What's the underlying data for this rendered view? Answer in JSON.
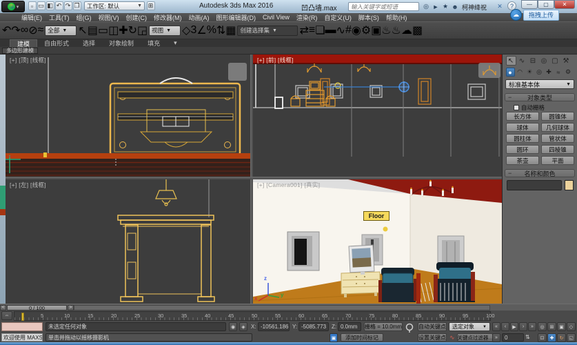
{
  "window": {
    "title": "Autodesk 3ds Max 2016",
    "doc": "凹凸墙.max",
    "workspace": "工作区: 默认",
    "search_placeholder": "输入关键字或短语",
    "username": "柯神绛祝",
    "upload_badge": "拖拽上传",
    "help": "?",
    "quick_icons": [
      {
        "n": "new-file-icon",
        "g": "▫"
      },
      {
        "n": "open-file-icon",
        "g": "▭"
      },
      {
        "n": "save-file-icon",
        "g": "◧"
      },
      {
        "n": "undo-quick-icon",
        "g": "↶"
      },
      {
        "n": "redo-quick-icon",
        "g": "↷"
      },
      {
        "n": "project-folder-icon",
        "g": "❐"
      }
    ],
    "title_icons": [
      {
        "n": "search-go-icon",
        "g": "◎"
      },
      {
        "n": "signin-icon",
        "g": "►"
      },
      {
        "n": "favorites-star-icon",
        "g": "★"
      },
      {
        "n": "user-icon",
        "g": "☻"
      }
    ],
    "controls": [
      {
        "n": "minimize-button",
        "g": "—"
      },
      {
        "n": "maximize-button",
        "g": "▢"
      },
      {
        "n": "close-button",
        "g": "✕",
        "cls": "close"
      }
    ]
  },
  "menu": {
    "items": [
      "编辑(E)",
      "工具(T)",
      "组(G)",
      "视图(V)",
      "创建(C)",
      "修改器(M)",
      "动画(A)",
      "图形编辑器(D)",
      "Civil View",
      "渲染(R)",
      "自定义(U)",
      "脚本(S)",
      "帮助(H)"
    ]
  },
  "toolbar": {
    "filter_label": "全部",
    "refcoord_label": "视图",
    "named_sets_label": "创建选择集",
    "icons_a": [
      {
        "n": "undo-icon",
        "g": "↶"
      },
      {
        "n": "redo-icon",
        "g": "↷"
      },
      {
        "n": "separator",
        "cls": "sep",
        "g": ""
      },
      {
        "n": "select-and-link-icon",
        "g": "∞"
      },
      {
        "n": "unlink-selection-icon",
        "g": "⊘"
      },
      {
        "n": "bind-to-spacewarp-icon",
        "g": "≈"
      },
      {
        "n": "separator",
        "cls": "sep",
        "g": ""
      }
    ],
    "icons_b": [
      {
        "n": "select-object-icon",
        "g": "↖"
      },
      {
        "n": "select-by-name-icon",
        "g": "▤"
      },
      {
        "n": "rect-selection-region-icon",
        "g": "▭"
      },
      {
        "n": "window-crossing-icon",
        "g": "◫"
      },
      {
        "n": "separator",
        "cls": "sep",
        "g": ""
      },
      {
        "n": "select-and-move-icon",
        "g": "✚"
      },
      {
        "n": "select-and-rotate-icon",
        "g": "↻"
      },
      {
        "n": "select-and-scale-icon",
        "g": "◲"
      }
    ],
    "icons_c": [
      {
        "n": "select-and-manipulate-icon",
        "g": "◇"
      },
      {
        "n": "separator",
        "cls": "sep",
        "g": ""
      },
      {
        "n": "snap-toggle-3d-icon",
        "g": "3",
        "hl": true,
        "cls": "snapnum"
      },
      {
        "n": "angle-snap-icon",
        "g": "∠",
        "hl": true
      },
      {
        "n": "percent-snap-icon",
        "g": "%"
      },
      {
        "n": "spinner-snap-icon",
        "g": "⇅"
      },
      {
        "n": "separator",
        "cls": "sep",
        "g": ""
      },
      {
        "n": "edit-named-sets-icon",
        "g": "▦"
      }
    ],
    "icons_d": [
      {
        "n": "mirror-icon",
        "g": "⇄"
      },
      {
        "n": "align-icon",
        "g": "≡"
      },
      {
        "n": "separator",
        "cls": "sep",
        "g": ""
      },
      {
        "n": "layer-manager-icon",
        "g": "❏"
      },
      {
        "n": "ribbon-toggle-icon",
        "g": "▬"
      },
      {
        "n": "separator",
        "cls": "sep",
        "g": ""
      },
      {
        "n": "curve-editor-icon",
        "g": "∿"
      },
      {
        "n": "schematic-view-icon",
        "g": "#"
      },
      {
        "n": "separator",
        "cls": "sep",
        "g": ""
      },
      {
        "n": "material-editor-icon",
        "g": "◉",
        "hl": true
      },
      {
        "n": "render-setup-icon",
        "g": "⚙"
      },
      {
        "n": "rendered-frame-icon",
        "g": "▣"
      },
      {
        "n": "render-production-icon",
        "g": "♨"
      },
      {
        "n": "render-iterative-icon",
        "g": "♨"
      },
      {
        "n": "render-cloud-icon",
        "g": "☁"
      },
      {
        "n": "render-last-icon",
        "g": "▩"
      }
    ]
  },
  "ribbon": {
    "tabs": [
      {
        "n": "ribbon-tab-modeling",
        "label": "建模",
        "cls": "active"
      },
      {
        "n": "ribbon-tab-freeform",
        "label": "自由形式"
      },
      {
        "n": "ribbon-tab-selection",
        "label": "选择"
      },
      {
        "n": "ribbon-tab-objectpaint",
        "label": "对象绘制"
      },
      {
        "n": "ribbon-tab-populate",
        "label": "填充"
      },
      {
        "n": "ribbon-minimize-icon",
        "label": "▾"
      }
    ],
    "panel_label": "多边形建模"
  },
  "viewports": {
    "top_left_label": "[+] [顶] [线框]",
    "top_right_label": "[+] [前] [线框]",
    "bottom_left_label": "[+] [左] [线框]",
    "camera_label": "[+] [Camera001] [真实]",
    "camera_tooltip": "Floor",
    "axis": {
      "x": "x",
      "y": "y",
      "z": "z"
    }
  },
  "command_panel": {
    "tabs": [
      {
        "n": "create-tab",
        "g": "↖",
        "cls": "active"
      },
      {
        "n": "modify-tab",
        "g": "∿"
      },
      {
        "n": "hierarchy-tab",
        "g": "⊟"
      },
      {
        "n": "motion-tab",
        "g": "◎"
      },
      {
        "n": "display-tab",
        "g": "▢"
      },
      {
        "n": "utilities-tab",
        "g": "⚒"
      }
    ],
    "categories": [
      {
        "n": "geometry-category",
        "g": "●",
        "cls": "active"
      },
      {
        "n": "shapes-category",
        "g": "◠"
      },
      {
        "n": "lights-category",
        "g": "☀"
      },
      {
        "n": "cameras-category",
        "g": "◎"
      },
      {
        "n": "helpers-category",
        "g": "✚"
      },
      {
        "n": "spacewarps-category",
        "g": "≈"
      },
      {
        "n": "systems-category",
        "g": "⚙"
      }
    ],
    "dropdown": "标准基本体",
    "rollout_object_type": "对象类型",
    "autogrid": "自动栅格",
    "object_buttons": [
      "长方体",
      "圆锥体",
      "球体",
      "几何球体",
      "圆柱体",
      "管状体",
      "圆环",
      "四棱锥",
      "茶壶",
      "平面"
    ],
    "rollout_name_color": "名称和颜色",
    "swatch_color": "#ecd29c"
  },
  "timeline": {
    "slider": "0 / 100",
    "prev_arrow": "<",
    "next_arrow": ">",
    "ruler_icon": "⇔",
    "ticks": [
      5,
      10,
      15,
      20,
      25,
      30,
      35,
      40,
      45,
      50,
      55,
      60,
      65,
      70,
      75,
      80,
      85,
      90,
      95,
      100
    ]
  },
  "status": {
    "listener_hint": "欢迎使用 MAXScr",
    "status_line": "未选定任何对象",
    "prompt_line": "单击并拖动以摇移摄影机",
    "mini_icons": [
      {
        "n": "isolate-selection-icon",
        "g": "◉"
      },
      {
        "n": "lock-selection-icon",
        "g": "◈"
      }
    ],
    "x_label": "X:",
    "x": "-10561.186",
    "y_label": "Y:",
    "y": "-5085.773",
    "z_label": "Z:",
    "z": "0.0mm",
    "grid": "栅格 = 10.0mm",
    "add_time_tag": "添加时间标记",
    "time_tag_glyph": "▣",
    "auto_key": "自动关键点",
    "set_key": "设置关键点",
    "selection_dropdown": "选定对象",
    "key_filters": "关键点过滤器...",
    "key_filter_glyph": "∿",
    "frame": "0",
    "spinner_glyph": "⇅",
    "playback1": [
      {
        "n": "go-to-start-button",
        "g": "«"
      },
      {
        "n": "prev-frame-button",
        "g": "‹"
      },
      {
        "n": "play-button",
        "g": "▶"
      },
      {
        "n": "next-frame-button",
        "g": "›"
      },
      {
        "n": "go-to-end-button",
        "g": "»"
      }
    ],
    "key-mode": "»",
    "nav1": [
      {
        "n": "zoom-icon",
        "g": "◎"
      },
      {
        "n": "zoom-all-icon",
        "g": "⊞"
      },
      {
        "n": "zoom-extents-icon",
        "g": "▣"
      },
      {
        "n": "fov-icon",
        "g": "◇"
      }
    ],
    "nav2": [
      {
        "n": "zoom-region-icon",
        "g": "⊡"
      },
      {
        "n": "pan-hand-icon",
        "g": "✚",
        "hl": true
      },
      {
        "n": "orbit-icon",
        "g": "↻",
        "cls": "orbit"
      },
      {
        "n": "maximize-viewport-icon",
        "g": "◱"
      }
    ]
  }
}
